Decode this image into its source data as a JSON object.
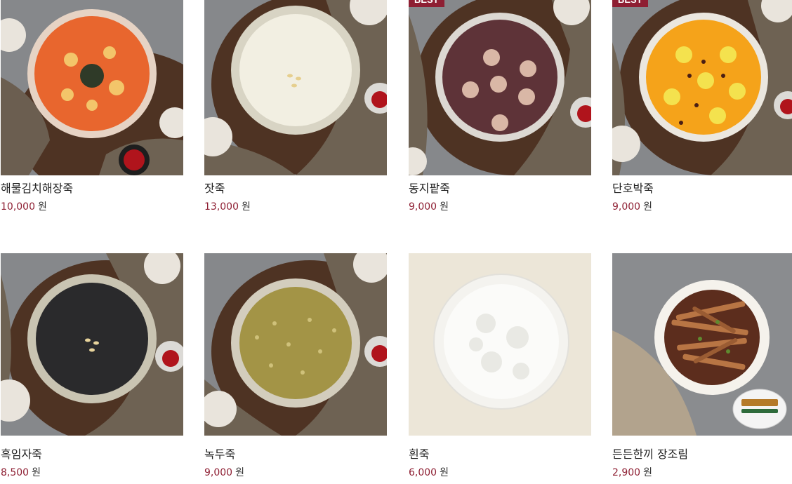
{
  "products": [
    {
      "name": "해물김치해장죽",
      "price": "10,000",
      "unit": "원",
      "badge": "",
      "image": "seafood-kimchi-porridge",
      "colors": {
        "bowl": "#e6d3c4",
        "fill": "#e8662e",
        "accent": "#f3c56a"
      }
    },
    {
      "name": "잣죽",
      "price": "13,000",
      "unit": "원",
      "badge": "",
      "image": "pine-nut-porridge",
      "colors": {
        "bowl": "#d8d4c4",
        "fill": "#f2efe2",
        "accent": "#e6cf8e"
      }
    },
    {
      "name": "동지팥죽",
      "price": "9,000",
      "unit": "원",
      "badge": "BEST",
      "image": "red-bean-porridge",
      "colors": {
        "bowl": "#dcd8d2",
        "fill": "#5e3338",
        "accent": "#d9b7a6"
      }
    },
    {
      "name": "단호박죽",
      "price": "9,000",
      "unit": "원",
      "badge": "BEST",
      "image": "pumpkin-porridge",
      "colors": {
        "bowl": "#ebe7df",
        "fill": "#f5a31a",
        "accent": "#f4e24e"
      }
    },
    {
      "name": "흑임자죽",
      "price": "8,500",
      "unit": "원",
      "badge": "",
      "image": "black-sesame-porridge",
      "colors": {
        "bowl": "#c9c4b2",
        "fill": "#2a2a2c",
        "accent": "#e8d49c"
      }
    },
    {
      "name": "녹두죽",
      "price": "9,000",
      "unit": "원",
      "badge": "",
      "image": "mung-bean-porridge",
      "colors": {
        "bowl": "#d3cdbd",
        "fill": "#a39446",
        "accent": "#cfc17a"
      }
    },
    {
      "name": "흰죽",
      "price": "6,000",
      "unit": "원",
      "badge": "",
      "image": "white-rice-porridge",
      "colors": {
        "bowl": "#f4f3ef",
        "fill": "#fbfbf9",
        "accent": "#e9e9e4"
      }
    },
    {
      "name": "든든한끼 장조림",
      "price": "2,900",
      "unit": "원",
      "badge": "",
      "image": "braised-beef-side-dish",
      "colors": {
        "bowl": "#f5f2ec",
        "fill": "#5c2d1d",
        "accent": "#b87544"
      }
    }
  ],
  "colors": {
    "price": "#8e1f33",
    "badge_bg": "#8e1f33",
    "table": "#7a7a7c",
    "tray": "#5a3a25",
    "cloth": "#6e6253",
    "beige_bg": "#ece6d8"
  }
}
